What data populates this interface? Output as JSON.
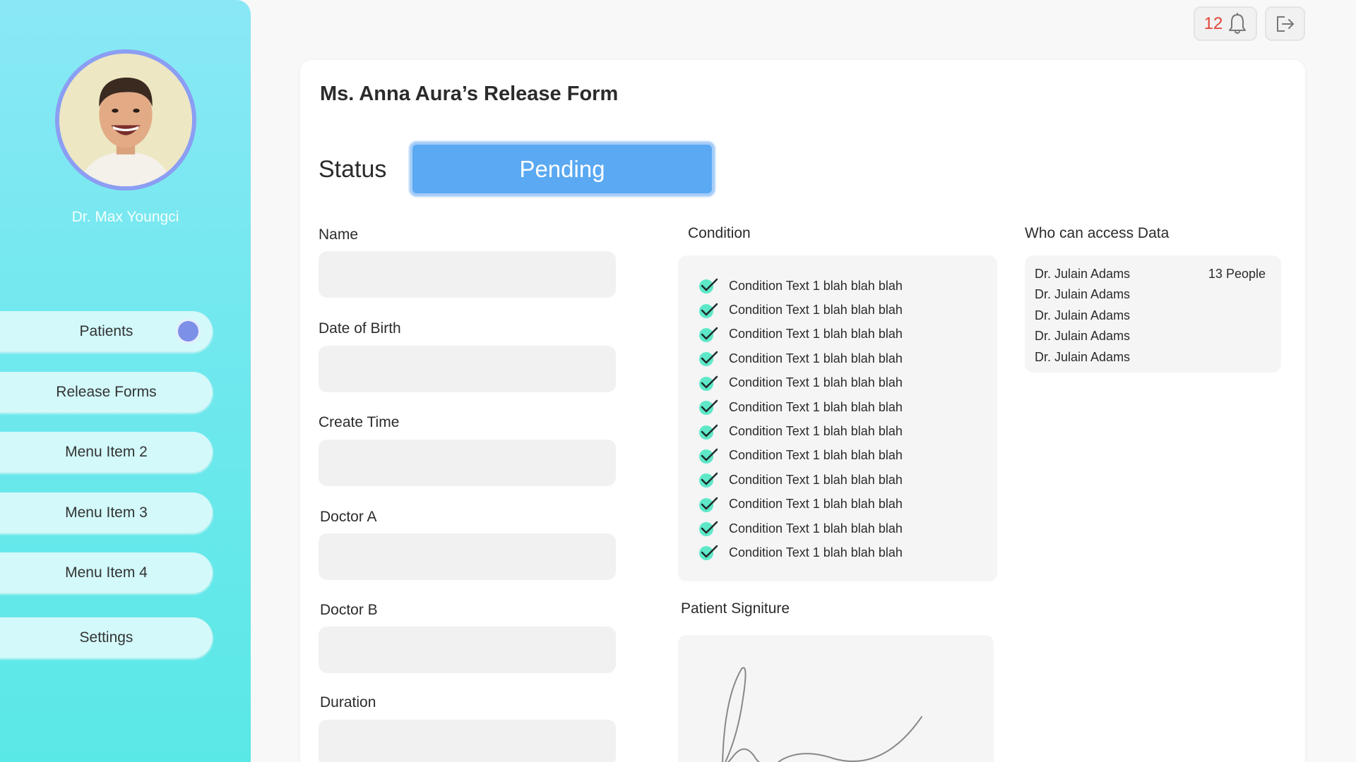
{
  "sidebar": {
    "doctor_name": "Dr. Max Youngci",
    "items": [
      {
        "label": "Patients"
      },
      {
        "label": "Release Forms"
      },
      {
        "label": "Menu Item 2"
      },
      {
        "label": "Menu Item 3"
      },
      {
        "label": "Menu Item 4"
      },
      {
        "label": "Settings"
      }
    ]
  },
  "topbar": {
    "notification_count": "12",
    "notification_icon": "bell-icon",
    "logout_icon": "logout-icon"
  },
  "form": {
    "title": "Ms. Anna Aura’s Release Form",
    "status_label": "Status",
    "status_value": "Pending",
    "fields": [
      {
        "label": "Name",
        "value": ""
      },
      {
        "label": "Date of Birth",
        "value": ""
      },
      {
        "label": "Create Time",
        "value": ""
      },
      {
        "label": "Doctor A",
        "value": ""
      },
      {
        "label": "Doctor B",
        "value": ""
      },
      {
        "label": "Duration",
        "value": ""
      }
    ],
    "condition": {
      "label": "Condition",
      "items": [
        "Condition Text 1 blah blah blah",
        "Condition Text 1 blah blah blah",
        "Condition Text 1 blah blah blah",
        "Condition Text 1 blah blah blah",
        "Condition Text 1 blah blah blah",
        "Condition Text 1 blah blah blah",
        "Condition Text 1 blah blah blah",
        "Condition Text 1 blah blah blah",
        "Condition Text 1 blah blah blah",
        "Condition Text 1 blah blah blah",
        "Condition Text 1 blah blah blah",
        "Condition Text 1 blah blah blah"
      ]
    },
    "access": {
      "label": "Who can access Data",
      "count": "13 People",
      "people": [
        "Dr. Julain Adams",
        "Dr. Julain Adams",
        "Dr. Julain Adams",
        "Dr. Julain Adams",
        "Dr. Julain Adams"
      ]
    },
    "signature": {
      "label": "Patient Signiture"
    }
  },
  "colors": {
    "sidebar_top": "#8ae8f5",
    "sidebar_bottom": "#5ae8e6",
    "status_badge": "#5aa9f2",
    "notification_count": "#e2463d",
    "check_accent": "#5ee8c8"
  }
}
